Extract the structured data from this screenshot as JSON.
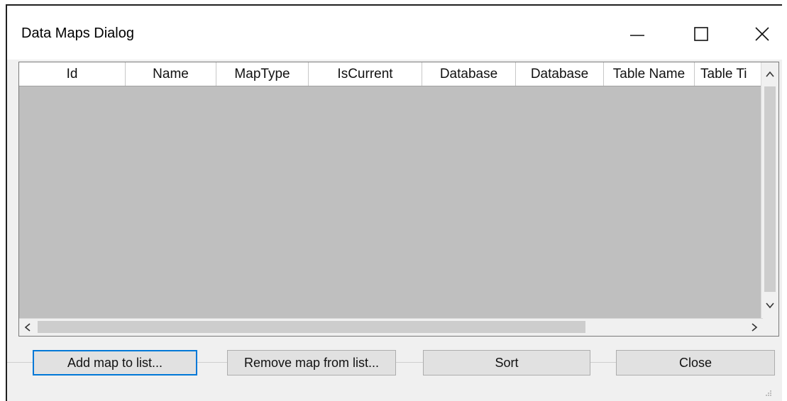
{
  "window": {
    "title": "Data Maps Dialog",
    "controls": {
      "minimize": "minimize-icon",
      "maximize": "maximize-icon",
      "close": "close-icon"
    }
  },
  "grid": {
    "columns": [
      "Id",
      "Name",
      "MapType",
      "IsCurrent",
      "Database",
      "Database",
      "Table Name",
      "Table Ti"
    ],
    "rows": []
  },
  "buttons": {
    "add": "Add map to list...",
    "remove": "Remove map from list...",
    "sort": "Sort",
    "close": "Close"
  }
}
